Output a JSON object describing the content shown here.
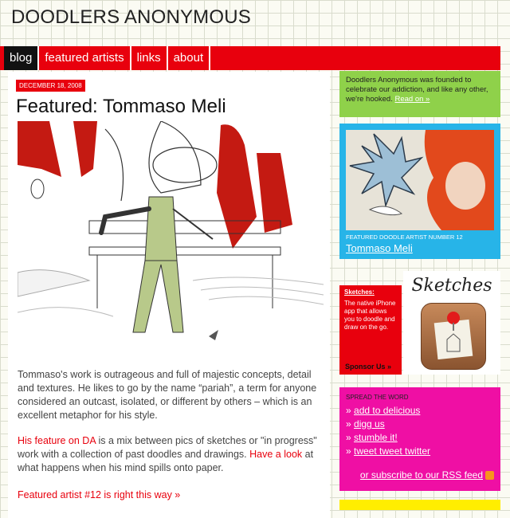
{
  "site": {
    "title": "DOODLERS ANONYMOUS"
  },
  "nav": {
    "items": [
      "blog",
      "featured artists",
      "links",
      "about"
    ]
  },
  "post": {
    "date": "DECEMBER 18, 2008",
    "title": "Featured: Tommaso Meli",
    "p1": "Tommaso's work is outrageous and full of majestic concepts, detail and textures. He likes to go by the name “pariah”, a term for anyone considered an outcast, isolated, or different by others – which is an excellent metaphor for his style.",
    "p2_link1": "His feature on DA",
    "p2_mid": " is a mix between pics of sketches or \"in progress\" work with a collection of past doodles and drawings. ",
    "p2_link2": "Have a look",
    "p2_end": " at what happens when his mind spills onto paper.",
    "p3_link": "Featured artist #12 is right this way »"
  },
  "sidebar": {
    "about_text": "Doodlers Anonymous was founded to celebrate our addiction, and like any other, we're hooked.",
    "about_link": "Read on »",
    "featured_label": "FEATURED DOODLE ARTIST NUMBER 12",
    "featured_name": "Tommaso Meli",
    "sketches_head": "Sketches:",
    "sketches_text": "The native iPhone app that allows you to doodle and draw on the go.",
    "sponsor": "Sponsor Us »",
    "app_word": "Sketches",
    "spread_label": "SPREAD THE WORD",
    "share_links": [
      "add to delicious",
      "digg us",
      "stumble it!",
      "tweet tweet twitter"
    ],
    "rss_text": "or subscribe to our RSS feed"
  },
  "colors": {
    "accent_red": "#e8000d",
    "green": "#8fd14a",
    "blue": "#27b4e8",
    "pink": "#ef0fa4",
    "yellow": "#ffee00"
  },
  "icons": [
    "rss-icon",
    "pushpin-icon"
  ]
}
